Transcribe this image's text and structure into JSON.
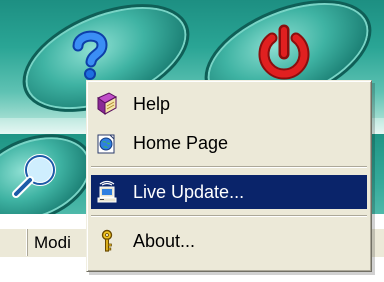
{
  "background_app": {
    "column_header": "Modi"
  },
  "context_menu": {
    "items": [
      {
        "label": "Help",
        "icon": "help-book-icon"
      },
      {
        "label": "Home Page",
        "icon": "home-page-globe-icon"
      },
      {
        "label": "Live Update...",
        "icon": "live-update-computer-icon",
        "highlighted": true
      },
      {
        "label": "About...",
        "icon": "about-key-icon"
      }
    ]
  },
  "colors": {
    "teal_skin": "#2aa595",
    "menu_background": "#ece9d8",
    "highlight": "#0a246a",
    "power_red": "#e02020",
    "help_blue": "#1e6fe0"
  }
}
